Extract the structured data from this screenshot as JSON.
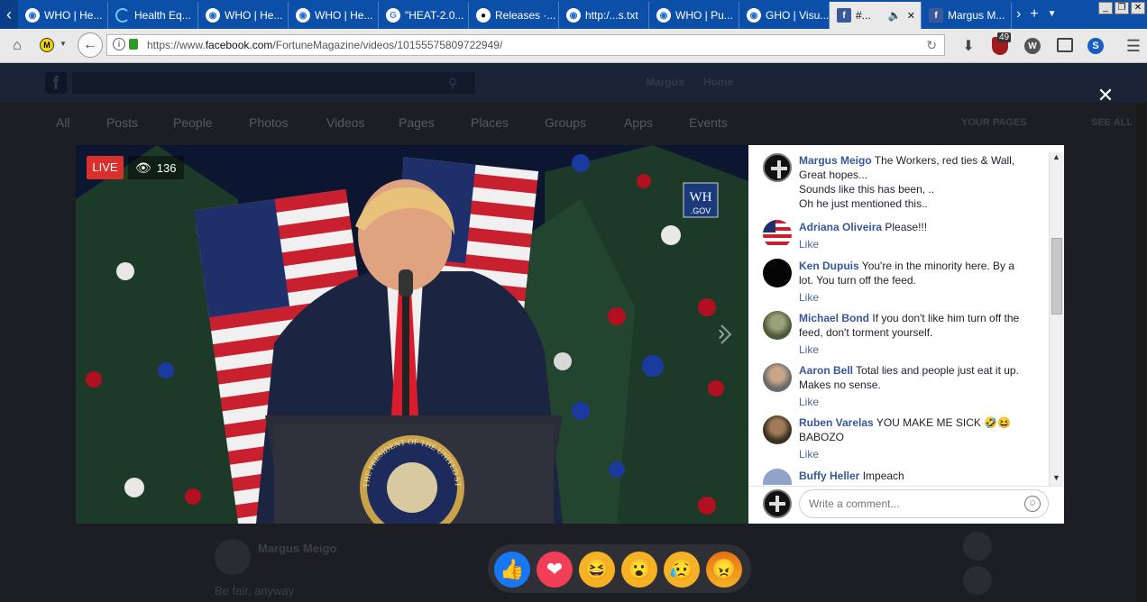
{
  "browser": {
    "tabs": [
      {
        "label": "WHO | He...",
        "icon": "who-icon"
      },
      {
        "label": "Health Eq...",
        "icon": "loading-icon"
      },
      {
        "label": "WHO | He...",
        "icon": "who-icon"
      },
      {
        "label": "WHO | He...",
        "icon": "who-icon"
      },
      {
        "label": "\"HEAT-2.0...",
        "icon": "google-icon"
      },
      {
        "label": "Releases ·...",
        "icon": "github-icon"
      },
      {
        "label": "http:/...s.txt",
        "icon": "who-icon"
      },
      {
        "label": "WHO | Pu...",
        "icon": "who-icon"
      },
      {
        "label": "GHO | Visu...",
        "icon": "who-icon"
      },
      {
        "label": "#...",
        "icon": "facebook-icon",
        "active": true
      },
      {
        "label": "Margus M...",
        "icon": "facebook-icon"
      }
    ],
    "url_prefix": "https://www.",
    "url_domain": "facebook.com",
    "url_path": "/FortuneMagazine/videos/10155575809722949/",
    "badge_count": "49"
  },
  "facebook": {
    "nav_user": "Margus",
    "nav_home": "Home",
    "tabs": [
      "All",
      "Posts",
      "People",
      "Photos",
      "Videos",
      "Pages",
      "Places",
      "Groups",
      "Apps",
      "Events"
    ],
    "your_pages": "YOUR PAGES",
    "see_all": "SEE ALL",
    "bg_author": "Margus Meigo",
    "bg_comment": "Be fair, anyway"
  },
  "video": {
    "live_label": "LIVE",
    "viewer_count": "136",
    "wh_logo_line1": "WH",
    "wh_logo_line2": ".GOV",
    "seal_text": "THE PRESIDENT OF THE UNITED STATES"
  },
  "comments": [
    {
      "author": "Margus Meigo",
      "text": "The Workers, red ties & Wall, Great hopes...",
      "extra": [
        "Sounds like this has been, ..",
        "Oh he just mentioned this.."
      ],
      "like": ""
    },
    {
      "author": "Adriana Oliveira",
      "text": "Please!!!",
      "extra": [],
      "like": "Like"
    },
    {
      "author": "Ken Dupuis",
      "text": "You're in the minority here. By a lot. You turn off the feed.",
      "extra": [],
      "like": "Like"
    },
    {
      "author": "Michael Bond",
      "text": "If you don't like him turn off the feed, don't torment yourself.",
      "extra": [],
      "like": "Like"
    },
    {
      "author": "Aaron Bell",
      "text": "Total lies and people just eat it up. Makes no sense.",
      "extra": [],
      "like": "Like"
    },
    {
      "author": "Ruben Varelas",
      "text": "YOU MAKE ME SICK 🤣😆 BABOZO",
      "extra": [],
      "like": "Like"
    },
    {
      "author": "Buffy Heller",
      "text": "Impeach",
      "extra": [],
      "like": ""
    }
  ],
  "comment_input": {
    "placeholder": "Write a comment..."
  },
  "reactions": [
    "like",
    "love",
    "haha",
    "wow",
    "sad",
    "angry"
  ]
}
